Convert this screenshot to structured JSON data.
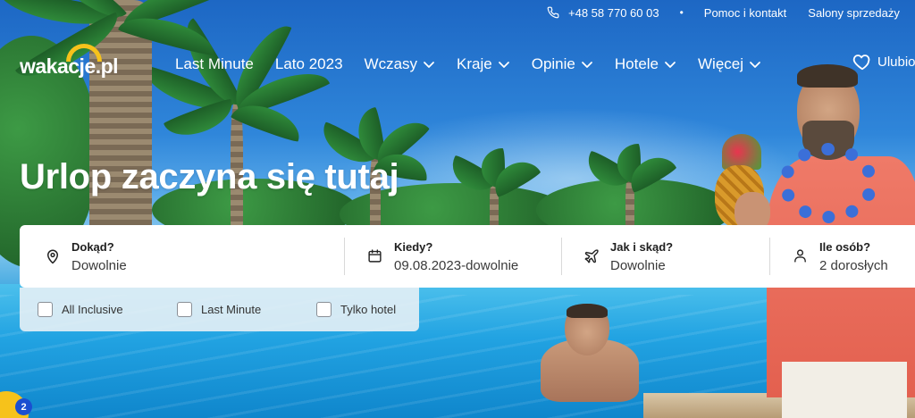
{
  "topbar": {
    "phone": "+48 58 770 60 03",
    "separator": "•",
    "help": "Pomoc i kontakt",
    "stores": "Salony sprzedaży"
  },
  "logo": {
    "text": "wakacje.pl"
  },
  "nav": {
    "items": [
      {
        "label": "Last Minute",
        "dropdown": false
      },
      {
        "label": "Lato 2023",
        "dropdown": false
      },
      {
        "label": "Wczasy",
        "dropdown": true
      },
      {
        "label": "Kraje",
        "dropdown": true
      },
      {
        "label": "Opinie",
        "dropdown": true
      },
      {
        "label": "Hotele",
        "dropdown": true
      },
      {
        "label": "Więcej",
        "dropdown": true
      }
    ],
    "favorites": "Ulubione"
  },
  "hero": {
    "title": "Urlop zaczyna się tutaj"
  },
  "search": {
    "destination": {
      "label": "Dokąd?",
      "value": "Dowolnie",
      "icon": "location-pin-icon"
    },
    "when": {
      "label": "Kiedy?",
      "value": "09.08.2023-dowolnie",
      "icon": "calendar-icon"
    },
    "transport": {
      "label": "Jak i skąd?",
      "value": "Dowolnie",
      "icon": "plane-icon"
    },
    "people": {
      "label": "Ile osób?",
      "value": "2 dorosłych",
      "icon": "person-icon"
    }
  },
  "options": [
    {
      "label": "All Inclusive",
      "checked": false
    },
    {
      "label": "Last Minute",
      "checked": false
    },
    {
      "label": "Tylko hotel",
      "checked": false
    }
  ],
  "badge": {
    "count": "2"
  },
  "colors": {
    "brand_yellow": "#f6c21b",
    "sky_blue": "#2f86da",
    "badge_blue": "#1a4fd1",
    "text_dark": "#1f1f1f"
  }
}
